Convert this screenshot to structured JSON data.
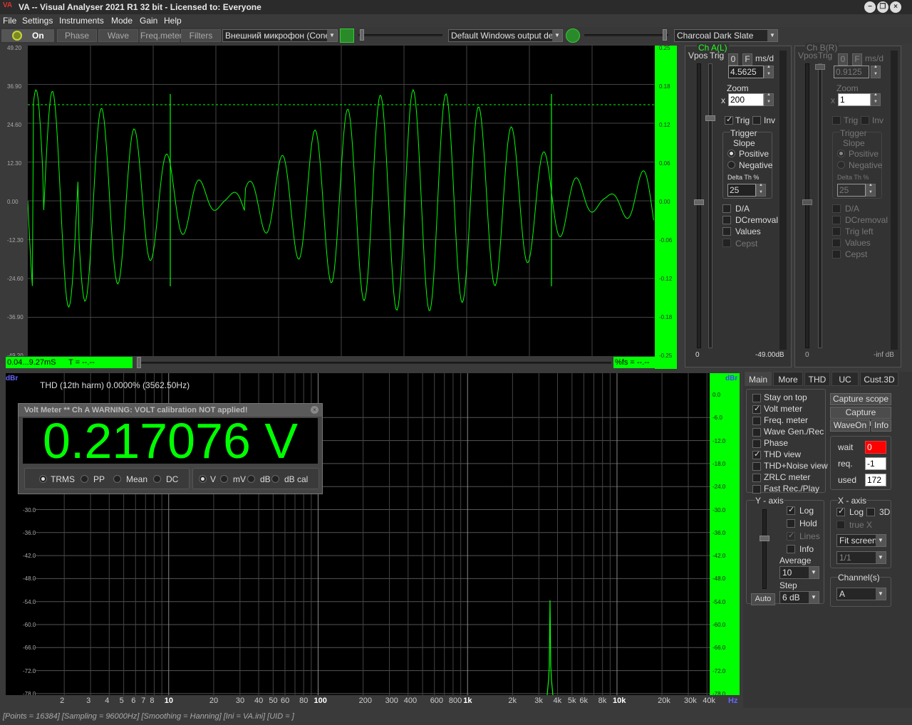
{
  "window": {
    "logo": "VA",
    "title": "VA -- Visual Analyser 2021 R1 32 bit - Licensed to: Everyone"
  },
  "menu": [
    "File",
    "Settings",
    "Instruments",
    "Mode",
    "Gain",
    "Help"
  ],
  "toolbar": {
    "on_label": "On",
    "phase": "Phase",
    "wave": "Wave",
    "freq_meter": "Freq.meter",
    "filters": "Filters",
    "input_device": "Внешний микрофон (Conexa",
    "output_device": "Default Windows output devic",
    "theme": "Charcoal Dark Slate"
  },
  "scope": {
    "left_ticks": [
      "49.20",
      "36.90",
      "24.60",
      "12.30",
      "0.00",
      "-12.30",
      "-24.60",
      "-36.90",
      "-49.20"
    ],
    "right_ticks": [
      "0.25",
      "0.18",
      "0.12",
      "0.06",
      "0.00",
      "-0.06",
      "-0.12",
      "-0.18",
      "-0.25"
    ],
    "time_range": "0.04...9.27mS",
    "t_readout": "T = --.--",
    "fs_readout": "%fs = --.--"
  },
  "chA": {
    "title": "Ch A(L)",
    "vpos": "Vpos",
    "trig": "Trig",
    "zero": "0",
    "f": "F",
    "msd": "ms/d",
    "time_val": "4.5625",
    "zoom_label": "Zoom",
    "x": "x",
    "zoom_val": "200",
    "trig_cb": "Trig",
    "inv_cb": "Inv",
    "trigger_label": "Trigger",
    "slope_label": "Slope",
    "positive": "Positive",
    "negative": "Negative",
    "delta_label": "Delta Th %",
    "delta_val": "25",
    "da": "D/A",
    "dcremoval": "DCremoval",
    "values": "Values",
    "cepst": "Cepst",
    "bottom_left": "0",
    "bottom_right": "-49.00dB"
  },
  "chB": {
    "title": "Ch B(R)",
    "vpos": "Vpos",
    "trig": "Trig",
    "zero": "0",
    "f": "F",
    "msd": "ms/d",
    "time_val": "0.9125",
    "zoom_label": "Zoom",
    "x": "x",
    "zoom_val": "1",
    "trig_cb": "Trig",
    "inv_cb": "Inv",
    "trigger_label": "Trigger",
    "slope_label": "Slope",
    "positive": "Positive",
    "negative": "Negative",
    "delta_label": "Delta Th %",
    "delta_val": "25",
    "da": "D/A",
    "dcremoval": "DCremoval",
    "trig_left": "Trig left",
    "values": "Values",
    "cepst": "Cepst",
    "bottom_left": "0",
    "bottom_right": "-inf dB"
  },
  "spectrum": {
    "unit_left": "dBr",
    "unit_right": "dBr",
    "thd_text": "THD (12th harm) 0.0000% (3562.50Hz)",
    "db_ticks": [
      "0.0",
      "-6.0",
      "-12.0",
      "-18.0",
      "-24.0",
      "-30.0",
      "-36.0",
      "-42.0",
      "-48.0",
      "-54.0",
      "-60.0",
      "-66.0",
      "-72.0",
      "-78.0"
    ],
    "freq_ticks": [
      {
        "t": "2"
      },
      {
        "t": "3"
      },
      {
        "t": "4"
      },
      {
        "t": "5"
      },
      {
        "t": "6"
      },
      {
        "t": "7"
      },
      {
        "t": "8"
      },
      {
        "t": "10",
        "b": true
      },
      {
        "t": "20"
      },
      {
        "t": "30"
      },
      {
        "t": "40"
      },
      {
        "t": "50"
      },
      {
        "t": "60"
      },
      {
        "t": "80"
      },
      {
        "t": "100",
        "b": true
      },
      {
        "t": "200"
      },
      {
        "t": "300"
      },
      {
        "t": "400"
      },
      {
        "t": "600"
      },
      {
        "t": "800"
      },
      {
        "t": "1k",
        "b": true
      },
      {
        "t": "2k"
      },
      {
        "t": "3k"
      },
      {
        "t": "4k"
      },
      {
        "t": "5k"
      },
      {
        "t": "6k"
      },
      {
        "t": "8k"
      },
      {
        "t": "10k",
        "b": true
      },
      {
        "t": "20k"
      },
      {
        "t": "30k"
      },
      {
        "t": "40k"
      }
    ],
    "hz": "Hz"
  },
  "voltmeter": {
    "title": "Volt Meter ** Ch A  WARNING: VOLT calibration NOT applied!",
    "value": "0.217076 V",
    "modes": [
      "TRMS",
      "PP",
      "Mean",
      "DC"
    ],
    "units": [
      "V",
      "mV",
      "dB",
      "dB cal"
    ]
  },
  "rpanel": {
    "tabs": [
      "Main",
      "More",
      "THD",
      "UC",
      "Cust.3D"
    ],
    "checks": [
      {
        "l": "Stay on top",
        "on": false
      },
      {
        "l": "Volt meter",
        "on": true
      },
      {
        "l": "Freq. meter",
        "on": false
      },
      {
        "l": "Wave Gen./Rec",
        "on": false
      },
      {
        "l": "Phase",
        "on": false
      },
      {
        "l": "THD view",
        "on": true
      },
      {
        "l": "THD+Noise view",
        "on": false
      },
      {
        "l": "ZRLC meter",
        "on": false
      },
      {
        "l": "Fast Rec./Play",
        "on": false
      }
    ],
    "capture_scope": "Capture scope",
    "capture_spectrum": "Capture spectrum",
    "waveon": "WaveOn",
    "info": "Info",
    "wait": "wait",
    "wait_val": "0",
    "req": "req.",
    "req_val": "-1",
    "used": "used",
    "used_val": "172",
    "yaxis": "Y - axis",
    "log": "Log",
    "hold": "Hold",
    "lines": "Lines",
    "info2": "Info",
    "average": "Average",
    "avg_val": "10",
    "step": "Step",
    "step_val": "6 dB",
    "auto": "Auto",
    "xaxis": "X - axis",
    "xlog": "Log",
    "x3d": "3D",
    "truex": "true X",
    "fit": "Fit screen",
    "ratio": "1/1",
    "channels": "Channel(s)",
    "ch_val": "A"
  },
  "status": "[Points = 16384]  [Sampling = 96000Hz]  [Smoothing = Hanning]  [Ini = VA.ini]  [UID = ]",
  "colors": {
    "trace": "#00ff00",
    "bg": "#000000"
  },
  "chart_data": {
    "type": "line",
    "series": [
      {
        "name": "Ch A",
        "peak_freq_hz": 3562.5,
        "peak_db": -55
      }
    ]
  }
}
